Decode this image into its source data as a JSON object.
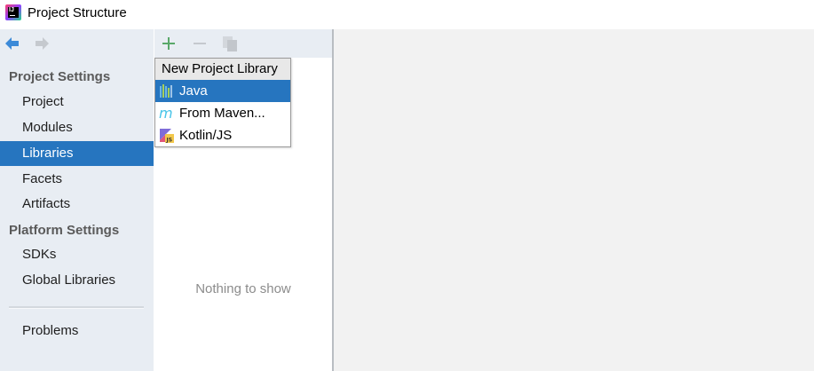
{
  "window": {
    "title": "Project Structure"
  },
  "sidebar": {
    "project_settings_header": "Project Settings",
    "project_settings_items": [
      {
        "label": "Project"
      },
      {
        "label": "Modules"
      },
      {
        "label": "Libraries",
        "selected": true
      },
      {
        "label": "Facets"
      },
      {
        "label": "Artifacts"
      }
    ],
    "platform_settings_header": "Platform Settings",
    "platform_settings_items": [
      {
        "label": "SDKs"
      },
      {
        "label": "Global Libraries"
      }
    ],
    "problems_label": "Problems"
  },
  "middle_panel": {
    "empty_text": "Nothing to show"
  },
  "popup": {
    "title": "New Project Library",
    "items": [
      {
        "label": "Java",
        "icon": "java-library-icon",
        "selected": true
      },
      {
        "label": "From Maven...",
        "icon": "maven-icon"
      },
      {
        "label": "Kotlin/JS",
        "icon": "kotlin-js-icon"
      }
    ]
  },
  "colors": {
    "selection": "#2675bf",
    "sidebar_bg": "#e8edf3",
    "content_bg": "#f2f2f2",
    "add_green": "#59a869"
  }
}
